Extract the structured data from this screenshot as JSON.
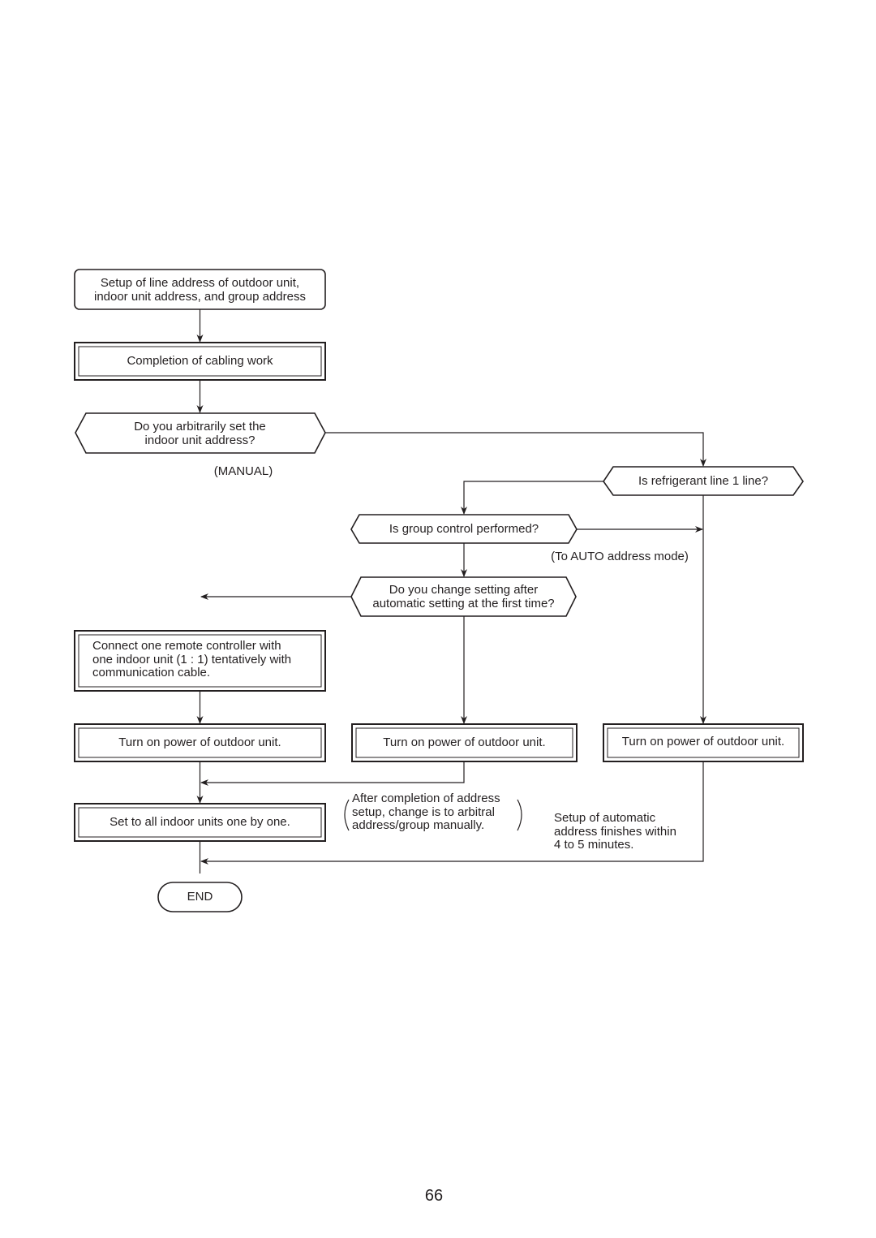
{
  "flowchart": {
    "start_box": [
      "Setup of line address of outdoor unit,",
      "indoor unit address, and group address"
    ],
    "cabling_box": "Completion of cabling work",
    "decision_arbitrary": [
      "Do you arbitrarily set the",
      "indoor unit address?"
    ],
    "manual_label": "(MANUAL)",
    "decision_refrigerant": "Is refrigerant line 1 line?",
    "decision_group": "Is group control performed?",
    "auto_label": "(To AUTO address mode)",
    "decision_change": [
      "Do you change setting after",
      "automatic setting at the first time?"
    ],
    "connect_box": [
      "Connect one remote controller with",
      "one indoor unit (1 : 1) tentatively with",
      "communication cable."
    ],
    "power_box_1": "Turn on power of outdoor unit.",
    "power_box_2": "Turn on power of outdoor unit.",
    "power_box_3": "Turn on power of outdoor unit.",
    "set_all_box": "Set to all indoor units one by one.",
    "note_after": [
      "After completion of address",
      "setup, change is to arbitral",
      "address/group manually."
    ],
    "note_auto": [
      "Setup of automatic",
      "address finishes within",
      "4 to 5 minutes."
    ],
    "end_label": "END"
  },
  "page_number": "66"
}
